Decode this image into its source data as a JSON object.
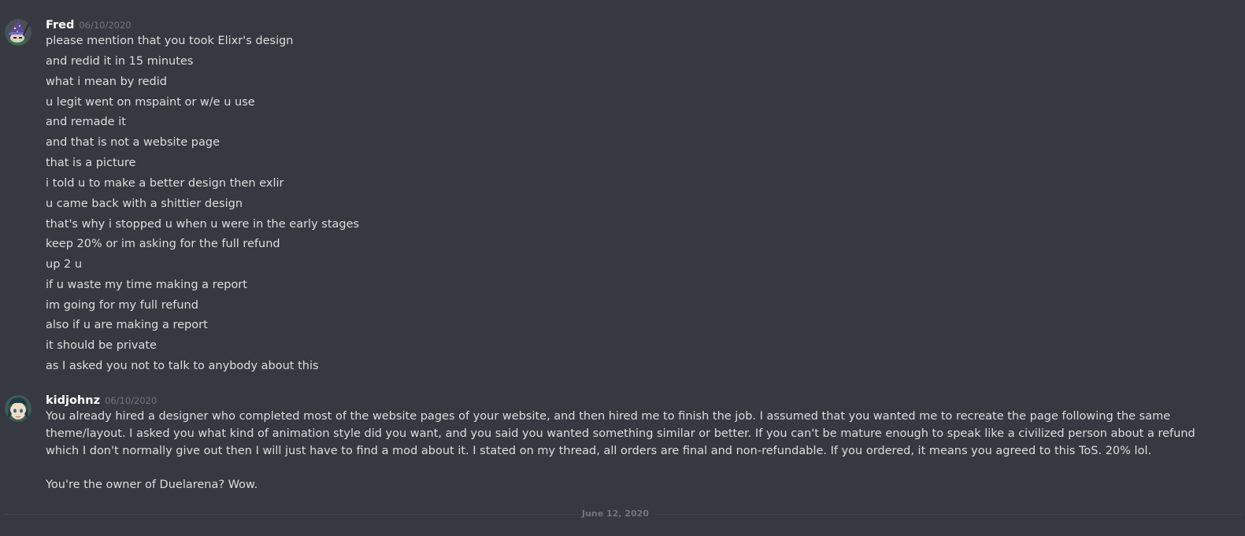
{
  "messages": [
    {
      "author": "Fred",
      "timestamp": "06/10/2020",
      "lines": [
        "please mention that you took Elixr's design",
        "and redid it in 15 minutes",
        "what i mean by redid",
        "u legit went on mspaint or w/e u use",
        "and remade it",
        "and that is not a website page",
        "that is a picture",
        "i told u to make a better design then exlir",
        "u came back with a shittier design",
        "that's why i stopped u when u were in the early stages",
        "keep 20% or im asking for the full refund",
        "up 2 u",
        "if u waste my time making a report",
        "im going for my full refund",
        "also if u are making a report",
        "it should be private",
        "as I asked you not to talk to anybody about this"
      ]
    },
    {
      "author": "kidjohnz",
      "timestamp": "06/10/2020",
      "paragraph": "You already hired a designer who completed most of the website pages of your website, and then hired me to finish the job. I assumed that you wanted me to recreate the page following the same theme/layout. I asked you what kind of animation style did you want, and you said you wanted something similar or better. If you can't be mature enough to speak like a civilized person  about a refund which I don't normally give out then I will just have to find a mod about it. I stated on my thread, all orders are final and non-refundable. If you ordered, it means you agreed to this ToS. 20% lol.",
      "followup": "You're the owner of Duelarena? Wow."
    }
  ],
  "date_divider": "June 12, 2020",
  "colors": {
    "background": "#36393f",
    "text": "#dcddde",
    "username": "#ffffff",
    "muted": "#72767d"
  },
  "icons": {
    "fred_avatar": "wizard-hat-avatar-icon",
    "kidjohnz_avatar": "anime-character-avatar-icon"
  }
}
